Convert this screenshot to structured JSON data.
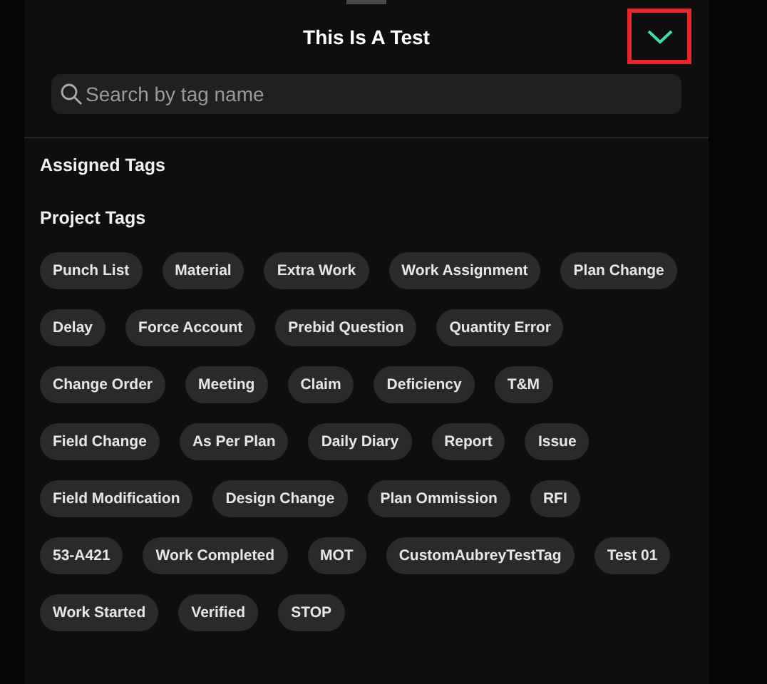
{
  "header": {
    "title": "This Is A Test",
    "collapse_highlighted": true
  },
  "search": {
    "placeholder": "Search by tag name"
  },
  "sections": [
    {
      "title": "Assigned Tags"
    },
    {
      "title": "Project Tags",
      "tag_rows": [
        [
          "Punch List",
          "Material",
          "Extra Work",
          "Work Assignment",
          "Plan Change"
        ],
        [
          "Delay",
          "Force Account",
          "Prebid Question",
          "Quantity Error"
        ],
        [
          "Change Order",
          "Meeting",
          "Claim",
          "Deficiency",
          "T&M"
        ],
        [
          "Field Change",
          "As Per Plan",
          "Daily Diary",
          "Report",
          "Issue"
        ],
        [
          "Field Modification",
          "Design Change",
          "Plan Ommission",
          "RFI"
        ],
        [
          "53-A421",
          "Work Completed",
          "MOT",
          "CustomAubreyTestTag",
          "Test 01"
        ],
        [
          "Work Started",
          "Verified",
          "STOP"
        ]
      ]
    }
  ]
}
